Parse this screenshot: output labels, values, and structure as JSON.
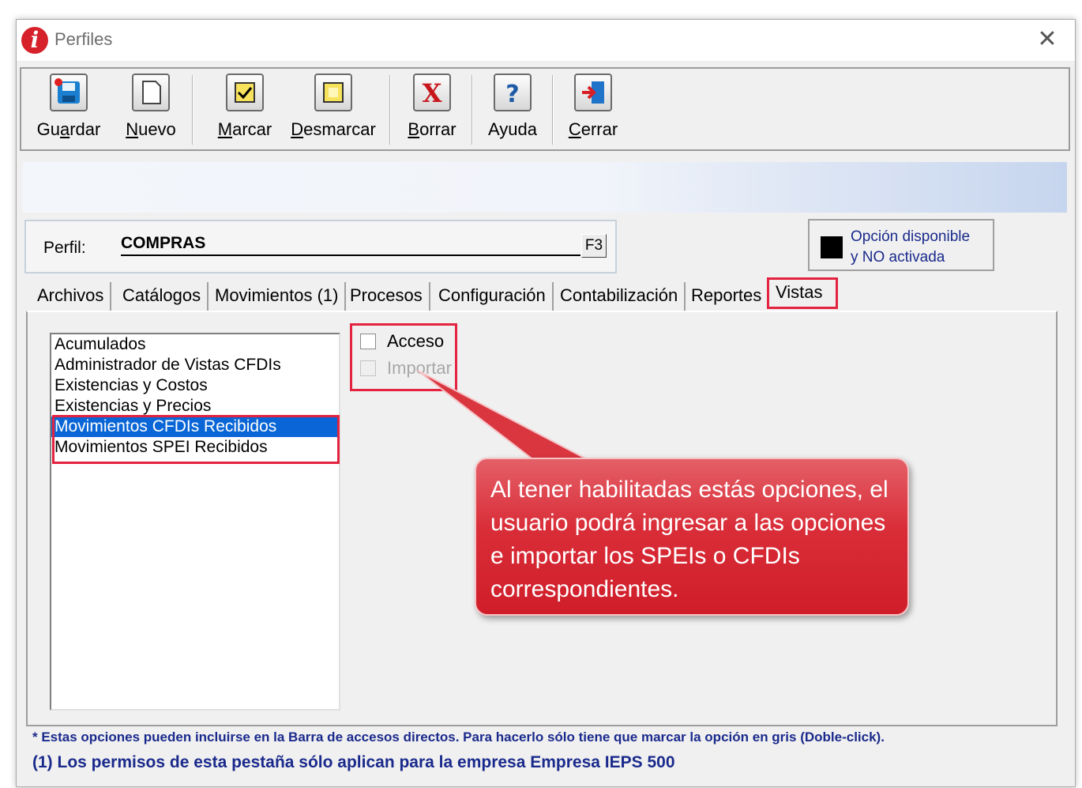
{
  "window": {
    "title": "Perfiles",
    "logo_icon": "app-logo-icon",
    "close_symbol": "✕"
  },
  "toolbar": {
    "buttons": [
      {
        "label_pre": "Gu",
        "label_u": "a",
        "label_post": "rdar",
        "icon": "save-icon"
      },
      {
        "label_pre": "",
        "label_u": "N",
        "label_post": "uevo",
        "icon": "new-document-icon"
      },
      {
        "label_pre": "",
        "label_u": "M",
        "label_post": "arcar",
        "icon": "checkbox-checked-icon"
      },
      {
        "label_pre": "",
        "label_u": "D",
        "label_post": "esmarcar",
        "icon": "checkbox-clear-icon"
      },
      {
        "label_pre": "",
        "label_u": "B",
        "label_post": "orrar",
        "icon": "delete-x-icon"
      },
      {
        "label_pre": "",
        "label_u": "",
        "label_post": "Ayuda",
        "icon": "help-icon"
      },
      {
        "label_pre": "",
        "label_u": "C",
        "label_post": "errar",
        "icon": "exit-icon"
      }
    ]
  },
  "perfil": {
    "label": "Perfil:",
    "value": "COMPRAS",
    "lookup_key": "F3"
  },
  "legend": {
    "text_line1": "Opción disponible",
    "text_line2": "y NO activada",
    "swatch_color": "#000000"
  },
  "tabs": [
    {
      "label": "Archivos",
      "active": false
    },
    {
      "label": "Catálogos",
      "active": false
    },
    {
      "label": "Movimientos (1)",
      "active": false
    },
    {
      "label": "Procesos",
      "active": false
    },
    {
      "label": "Configuración",
      "active": false
    },
    {
      "label": "Contabilización",
      "active": false
    },
    {
      "label": "Reportes",
      "active": false
    },
    {
      "label": "Vistas",
      "active": true
    }
  ],
  "vistas_list": {
    "items": [
      {
        "label": "Acumulados",
        "selected": false
      },
      {
        "label": "Administrador de Vistas CFDIs",
        "selected": false
      },
      {
        "label": "Existencias y Costos",
        "selected": false
      },
      {
        "label": "Existencias y Precios",
        "selected": false
      },
      {
        "label": "Movimientos CFDIs Recibidos",
        "selected": true
      },
      {
        "label": "Movimientos SPEI Recibidos",
        "selected": false
      }
    ]
  },
  "permissions": {
    "acceso": {
      "label": "Acceso",
      "checked": false,
      "enabled": true
    },
    "importar": {
      "label": "Importar",
      "checked": false,
      "enabled": false
    }
  },
  "callout": {
    "text": "Al tener habilitadas estás opciones, el usuario podrá ingresar a las opciones e importar los SPEIs o CFDIs correspondientes."
  },
  "footer": {
    "note1": "* Estas opciones pueden incluirse en la Barra de accesos directos. Para hacerlo sólo tiene que marcar la opción en gris (Doble-click).",
    "note2": "(1) Los permisos de esta pestaña sólo aplican para la empresa Empresa IEPS 500"
  },
  "colors": {
    "highlight_border": "#e3233f",
    "selection": "#0a66d6",
    "note_text": "#1a2a8c",
    "callout_fill": "#d92d38"
  }
}
